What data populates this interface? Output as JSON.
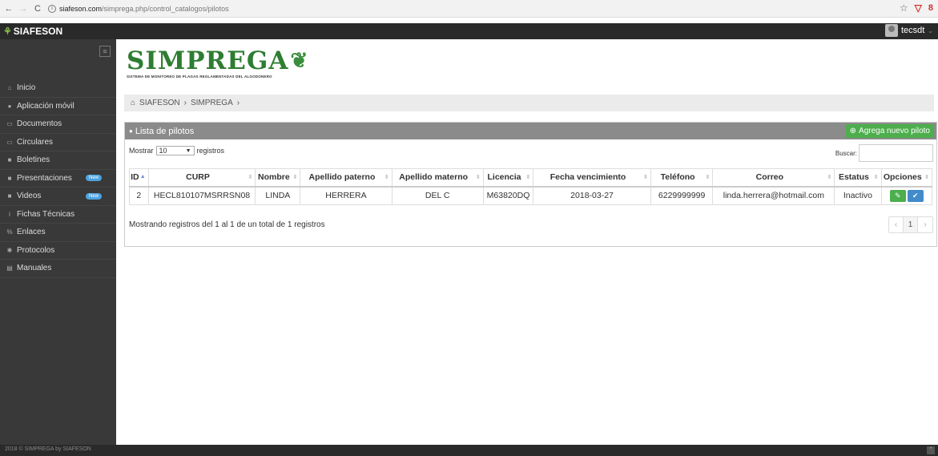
{
  "browser": {
    "url_host": "siafeson.com",
    "url_path": "/simprega.php/control_catalogos/pilotos"
  },
  "topbar": {
    "brand": "SIAFESON",
    "user": "tecsdt"
  },
  "sidebar": {
    "items": [
      {
        "label": "Inicio",
        "icon": "home-icon",
        "glyph": "⌂"
      },
      {
        "label": "Aplicación móvil",
        "icon": "mobile-icon",
        "glyph": "●"
      },
      {
        "label": "Documentos",
        "icon": "folder-icon",
        "glyph": "▭"
      },
      {
        "label": "Circulares",
        "icon": "folder-open-icon",
        "glyph": "▭"
      },
      {
        "label": "Boletines",
        "icon": "file-icon",
        "glyph": "■"
      },
      {
        "label": "Presentaciones",
        "icon": "file-icon",
        "glyph": "■",
        "badge": "New"
      },
      {
        "label": "Videos",
        "icon": "video-icon",
        "glyph": "■",
        "badge": "New"
      },
      {
        "label": "Fichas Técnicas",
        "icon": "info-icon",
        "glyph": "i"
      },
      {
        "label": "Enlaces",
        "icon": "link-icon",
        "glyph": "%"
      },
      {
        "label": "Protocolos",
        "icon": "gear-icon",
        "glyph": "✱"
      },
      {
        "label": "Manuales",
        "icon": "book-icon",
        "glyph": "▤"
      }
    ]
  },
  "logo": {
    "word": "SIMPREGA",
    "subtitle": "SISTEMA DE MONITOREO DE PLAGAS REGLAMENTADAS DEL ALGODONERO"
  },
  "breadcrumb": {
    "items": [
      "SIAFESON",
      "SIMPREGA"
    ]
  },
  "panel": {
    "title": "Lista de pilotos",
    "add_button": "Agrega nuevo piloto",
    "show_prefix": "Mostrar",
    "show_value": "10",
    "show_suffix": "registros",
    "search_label": "Buscar:",
    "info": "Mostrando registros del 1 al 1 de un total de 1 registros",
    "page": "1"
  },
  "table": {
    "columns": [
      "ID",
      "CURP",
      "Nombre",
      "Apellido paterno",
      "Apellido materno",
      "Licencia",
      "Fecha vencimiento",
      "Teléfono",
      "Correo",
      "Estatus",
      "Opciones"
    ],
    "rows": [
      [
        "2",
        "HECL810107MSRRSN08",
        "LINDA",
        "HERRERA",
        "DEL C",
        "M63820DQ",
        "2018-03-27",
        "6229999999",
        "linda.herrera@hotmail.com",
        "Inactivo"
      ]
    ]
  },
  "footer": {
    "text": "2018 © SIMPREGA by SIAFESON"
  },
  "colors": {
    "accent_green": "#4cae4c",
    "accent_blue": "#428bca",
    "sidebar_bg": "#393939",
    "logo_green": "#2e7d32"
  }
}
